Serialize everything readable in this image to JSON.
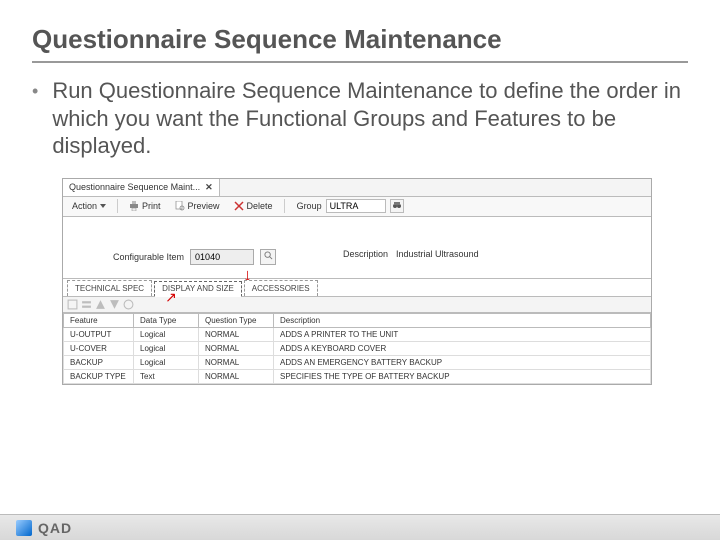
{
  "title": "Questionnaire Sequence Maintenance",
  "bullet": "Run Questionnaire Sequence Maintenance to define the order in which you want the Functional Groups and Features to be displayed.",
  "app": {
    "window_tab": "Questionnaire Sequence Maint...",
    "toolbar": {
      "action": "Action",
      "print": "Print",
      "preview": "Preview",
      "delete": "Delete",
      "group_label": "Group",
      "group_value": "ULTRA"
    },
    "header": {
      "item_label": "Configurable Item",
      "item_value": "01040",
      "desc_label": "Description",
      "desc_value": "Industrial Ultrasound"
    },
    "sub_tabs": [
      {
        "label": "TECHNICAL SPEC",
        "active": false
      },
      {
        "label": "DISPLAY AND SIZE",
        "active": true
      },
      {
        "label": "ACCESSORIES",
        "active": false
      }
    ],
    "grid": {
      "columns": [
        "Feature",
        "Data Type",
        "Question Type",
        "Description"
      ],
      "rows": [
        {
          "feature": "U-OUTPUT",
          "datatype": "Logical",
          "qtype": "NORMAL",
          "desc": "ADDS A PRINTER TO THE UNIT"
        },
        {
          "feature": "U-COVER",
          "datatype": "Logical",
          "qtype": "NORMAL",
          "desc": "ADDS A KEYBOARD COVER"
        },
        {
          "feature": "BACKUP",
          "datatype": "Logical",
          "qtype": "NORMAL",
          "desc": "ADDS AN EMERGENCY BATTERY BACKUP"
        },
        {
          "feature": "BACKUP TYPE",
          "datatype": "Text",
          "qtype": "NORMAL",
          "desc": "SPECIFIES THE TYPE OF BATTERY BACKUP"
        }
      ]
    }
  },
  "footer": {
    "brand": "QAD"
  }
}
